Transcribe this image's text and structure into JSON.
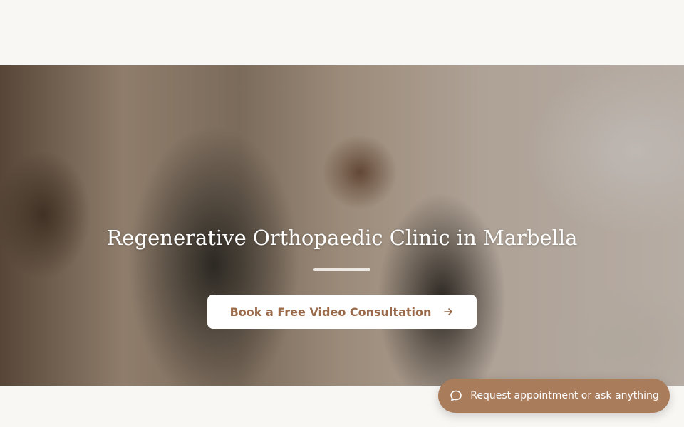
{
  "hero": {
    "title": "Regenerative Orthopaedic Clinic in Marbella",
    "cta_label": "Book a Free Video Consultation",
    "cta_icon": "arrow-right-icon"
  },
  "chat": {
    "label": "Request appointment or ask anything",
    "icon": "chat-bubble-icon"
  },
  "colors": {
    "background": "#f9f7f4",
    "accent": "#a97c5b",
    "cta_text": "#9a6a4a"
  }
}
